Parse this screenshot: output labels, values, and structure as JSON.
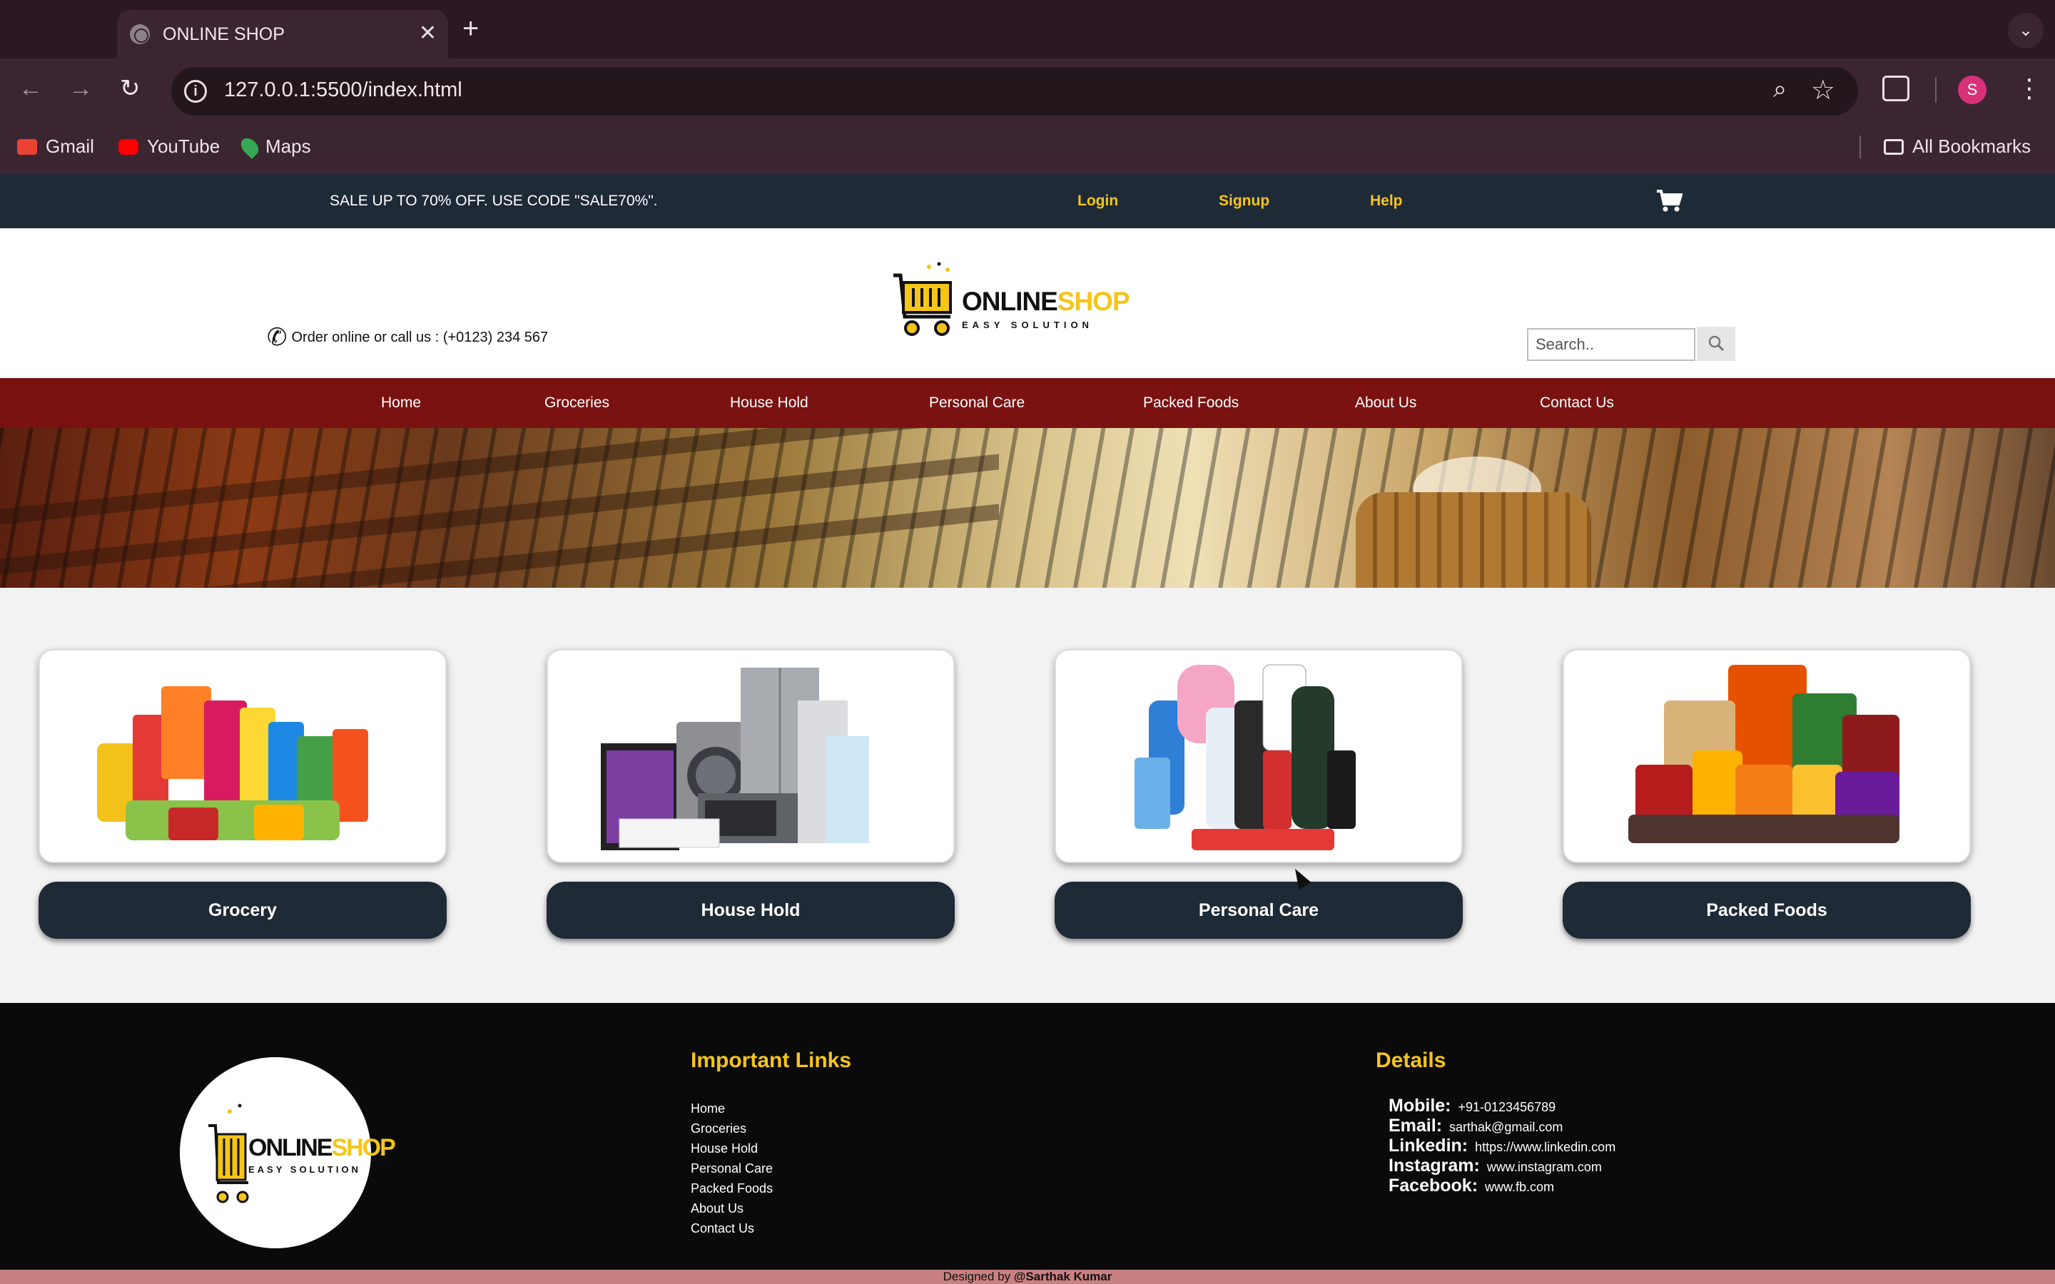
{
  "browser": {
    "tab_title": "ONLINE SHOP",
    "url": "127.0.0.1:5500/index.html",
    "profile_initial": "S",
    "bookmarks": [
      "Gmail",
      "YouTube",
      "Maps"
    ],
    "all_bookmarks": "All Bookmarks"
  },
  "topbar": {
    "promo": "SALE UP TO 70% OFF. USE CODE \"SALE70%\".",
    "login": "Login",
    "signup": "Signup",
    "help": "Help"
  },
  "header": {
    "call_text": "Order online or call us : (+0123) 234 567",
    "logo_brand_a": "ONLINE",
    "logo_brand_b": "SHOP",
    "logo_tagline": "EASY SOLUTION",
    "search_placeholder": "Search.."
  },
  "nav": [
    "Home",
    "Groceries",
    "House Hold",
    "Personal Care",
    "Packed Foods",
    "About Us",
    "Contact Us"
  ],
  "categories": [
    {
      "label": "Grocery"
    },
    {
      "label": "House Hold"
    },
    {
      "label": "Personal Care"
    },
    {
      "label": "Packed Foods"
    }
  ],
  "footer": {
    "links_heading": "Important Links",
    "links": [
      "Home",
      "Groceries",
      "House Hold",
      "Personal Care",
      "Packed Foods",
      "About Us",
      "Contact Us"
    ],
    "details_heading": "Details",
    "details": [
      {
        "key": "Mobile:",
        "value": "+91-0123456789"
      },
      {
        "key": "Email:",
        "value": "sarthak@gmail.com"
      },
      {
        "key": "Linkedin:",
        "value": "https://www.linkedin.com"
      },
      {
        "key": "Instagram:",
        "value": "www.instagram.com"
      },
      {
        "key": "Facebook:",
        "value": "www.fb.com"
      }
    ],
    "credit_prefix": "Designed by",
    "credit_author": "@Sarthak Kumar"
  },
  "colors": {
    "topbar": "#1f2a37",
    "accent": "#f5c518",
    "nav": "#7a1212",
    "footer": "#0a0a0a"
  }
}
